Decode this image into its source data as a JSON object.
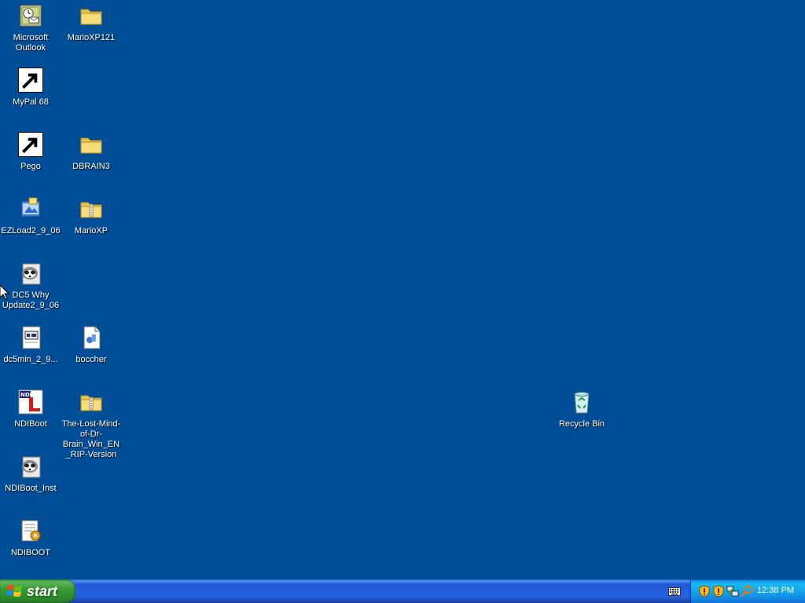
{
  "desktop": {
    "background_color": "#004e98",
    "icons": [
      {
        "id": "outlook",
        "label": "Microsoft Outlook",
        "icon": "outlook-icon"
      },
      {
        "id": "marioxp121",
        "label": "MarioXP121",
        "icon": "folder-icon"
      },
      {
        "id": "mypal",
        "label": "MyPal 68",
        "icon": "raccoon-icon",
        "shortcut": true
      },
      {
        "id": "pego",
        "label": "Pego",
        "icon": "red-ball-icon",
        "shortcut": true
      },
      {
        "id": "dbrain",
        "label": "DBRAIN3",
        "icon": "folder-icon"
      },
      {
        "id": "ezload",
        "label": "EZLoad2_9_06",
        "icon": "installer-icon"
      },
      {
        "id": "marioxp",
        "label": "MarioXP",
        "icon": "zip-folder-icon"
      },
      {
        "id": "dc5",
        "label": "DC5 Why Update2_9_06",
        "icon": "raccoon-installer-icon"
      },
      {
        "id": "dc5min",
        "label": "dc5min_2_9...",
        "icon": "document-icon"
      },
      {
        "id": "boccher",
        "label": "boccher",
        "icon": "media-file-icon"
      },
      {
        "id": "ndiboot",
        "label": "NDIBoot",
        "icon": "ndi-icon"
      },
      {
        "id": "lostmind",
        "label": "The-Lost-Mind-of-Dr-Brain_Win_EN_RIP-Version",
        "icon": "zip-folder-icon"
      },
      {
        "id": "ndiinst",
        "label": "NDIBoot_Inst",
        "icon": "raccoon-installer-icon"
      },
      {
        "id": "ndiboot2",
        "label": "NDIBOOT",
        "icon": "settings-file-icon"
      },
      {
        "id": "recycle",
        "label": "Recycle Bin",
        "icon": "recycle-bin-icon"
      }
    ]
  },
  "taskbar": {
    "start_label": "start",
    "clock": "12:38 PM",
    "tray_icons": [
      "shield-icon",
      "shield-icon",
      "network-icon",
      "search-icon"
    ]
  }
}
